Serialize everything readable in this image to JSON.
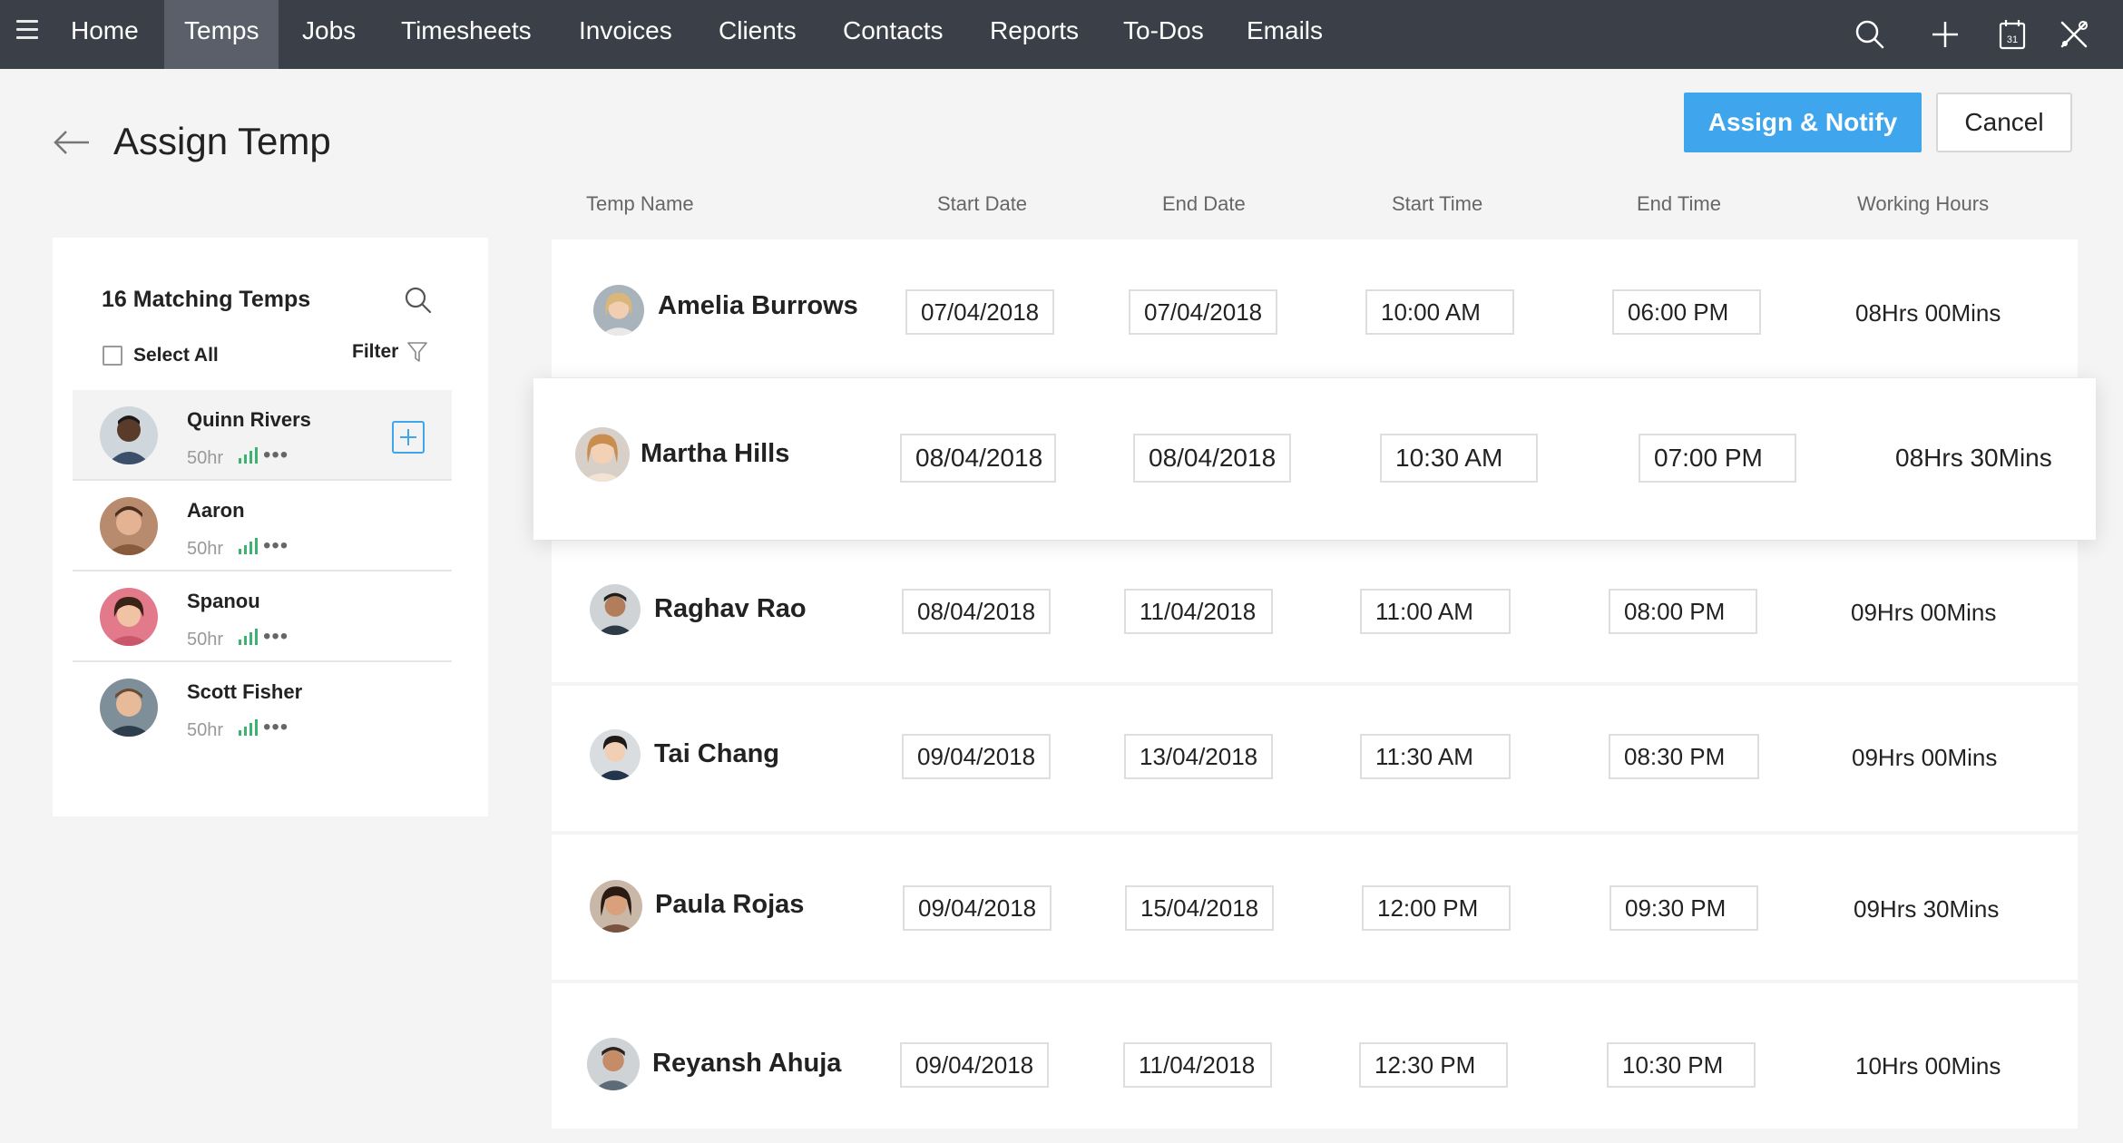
{
  "nav": {
    "items": [
      "Home",
      "Temps",
      "Jobs",
      "Timesheets",
      "Invoices",
      "Clients",
      "Contacts",
      "Reports",
      "To-Dos",
      "Emails"
    ],
    "active": "Temps",
    "icons": [
      "search-icon",
      "add-icon",
      "calendar-icon",
      "tools-icon"
    ],
    "calendar_day": "31"
  },
  "page": {
    "title": "Assign Temp",
    "assign_button": "Assign & Notify",
    "cancel_button": "Cancel"
  },
  "left_panel": {
    "title": "16 Matching Temps",
    "select_all": "Select All",
    "filter": "Filter",
    "temps": [
      {
        "name": "Quinn Rivers",
        "hours": "50hr",
        "selected": true
      },
      {
        "name": "Aaron",
        "hours": "50hr",
        "selected": false
      },
      {
        "name": "Spanou",
        "hours": "50hr",
        "selected": false
      },
      {
        "name": "Scott Fisher",
        "hours": "50hr",
        "selected": false
      }
    ],
    "more": "•••"
  },
  "table": {
    "headers": [
      "Temp Name",
      "Start Date",
      "End Date",
      "Start Time",
      "End Time",
      "Working Hours"
    ],
    "rows": [
      {
        "name": "Amelia Burrows",
        "start_date": "07/04/2018",
        "end_date": "07/04/2018",
        "start_time": "10:00 AM",
        "end_time": "06:00 PM",
        "hours": "08Hrs 00Mins"
      },
      {
        "name": "Martha Hills",
        "start_date": "08/04/2018",
        "end_date": "08/04/2018",
        "start_time": "10:30 AM",
        "end_time": "07:00 PM",
        "hours": "08Hrs 30Mins"
      },
      {
        "name": "Raghav Rao",
        "start_date": "08/04/2018",
        "end_date": "11/04/2018",
        "start_time": "11:00 AM",
        "end_time": "08:00 PM",
        "hours": "09Hrs 00Mins"
      },
      {
        "name": "Tai Chang",
        "start_date": "09/04/2018",
        "end_date": "13/04/2018",
        "start_time": "11:30 AM",
        "end_time": "08:30 PM",
        "hours": "09Hrs 00Mins"
      },
      {
        "name": "Paula Rojas",
        "start_date": "09/04/2018",
        "end_date": "15/04/2018",
        "start_time": "12:00 PM",
        "end_time": "09:30 PM",
        "hours": "09Hrs 30Mins"
      },
      {
        "name": "Reyansh Ahuja",
        "start_date": "09/04/2018",
        "end_date": "11/04/2018",
        "start_time": "12:30 PM",
        "end_time": "10:30 PM",
        "hours": "10Hrs 00Mins"
      }
    ]
  },
  "colors": {
    "nav_bg": "#3a3f48",
    "nav_active": "#5a5f69",
    "accent": "#3fa5ec",
    "signal": "#3cb371"
  }
}
